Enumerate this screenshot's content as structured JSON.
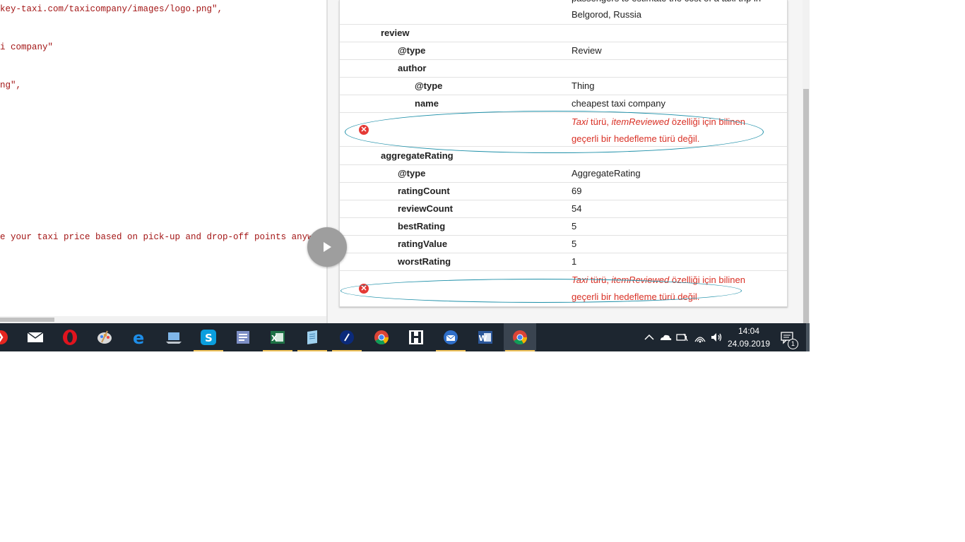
{
  "code": {
    "lines": [
      "key-taxi.com/taxicompany/images/logo.png\",",
      "i company\"",
      "ng\",",
      "e your taxi price based on pick-up and drop-off points anywhere"
    ]
  },
  "results": {
    "partial_text_line1": "passengers to estimate the cost of a taxi trip in",
    "partial_text_line2": "Belgorod, Russia",
    "rows": {
      "review": {
        "name": "review"
      },
      "review_type": {
        "name": "@type",
        "value": "Review"
      },
      "author": {
        "name": "author"
      },
      "author_type": {
        "name": "@type",
        "value": "Thing"
      },
      "author_name": {
        "name": "name",
        "value": "cheapest taxi company"
      },
      "aggregate": {
        "name": "aggregateRating"
      },
      "agg_type": {
        "name": "@type",
        "value": "AggregateRating"
      },
      "rating_count": {
        "name": "ratingCount",
        "value": "69"
      },
      "review_count": {
        "name": "reviewCount",
        "value": "54"
      },
      "best_rating": {
        "name": "bestRating",
        "value": "5"
      },
      "rating_value": {
        "name": "ratingValue",
        "value": "5"
      },
      "worst_rating": {
        "name": "worstRating",
        "value": "1"
      }
    },
    "error": {
      "type_word": "Taxi",
      "after_type": " türü, ",
      "property": "itemReviewed",
      "after_property": " özelliği için bilinen",
      "line2": "geçerli bir hedefleme türü değil.",
      "icon": "error-x-icon"
    }
  },
  "taskbar": {
    "apps": [
      "yandex-browser",
      "mail",
      "opera",
      "paint",
      "edge",
      "file-explorer",
      "skype",
      "outlook",
      "excel",
      "notepad",
      "app-blue",
      "chrome",
      "hadoop-app",
      "thunderbird",
      "word",
      "chrome-active"
    ],
    "time": "14:04",
    "date": "24.09.2019",
    "notification_count": "1"
  },
  "colors": {
    "error": "#d93025",
    "ellipse": "#1d8fa8",
    "taskbar": "#1d2630"
  }
}
